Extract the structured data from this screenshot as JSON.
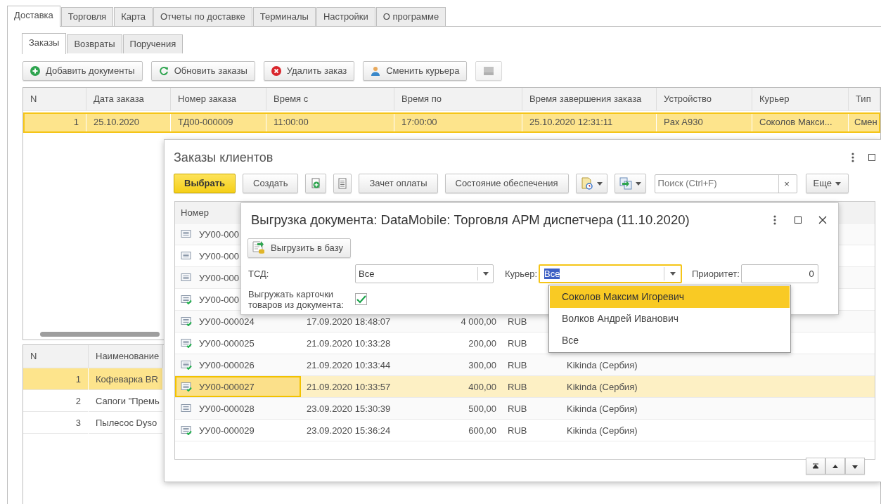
{
  "main_tabs": [
    {
      "label": "Доставка",
      "selected": true
    },
    {
      "label": "Торговля",
      "selected": false
    },
    {
      "label": "Карта",
      "selected": false
    },
    {
      "label": "Отчеты по доставке",
      "selected": false
    },
    {
      "label": "Терминалы",
      "selected": false
    },
    {
      "label": "Настройки",
      "selected": false
    },
    {
      "label": "О программе",
      "selected": false
    }
  ],
  "sub_tabs": [
    {
      "label": "Заказы",
      "selected": true
    },
    {
      "label": "Возвраты",
      "selected": false
    },
    {
      "label": "Поручения",
      "selected": false
    }
  ],
  "toolbar": [
    {
      "label": "Добавить документы",
      "disabled": false
    },
    {
      "label": "Обновить заказы",
      "disabled": false
    },
    {
      "label": "Удалить заказ",
      "disabled": false
    },
    {
      "label": "Сменить курьера",
      "disabled": false
    },
    {
      "disabled": true
    }
  ],
  "orders_table": {
    "columns": [
      "N",
      "Дата заказа",
      "Номер заказа",
      "Время с",
      "Время по",
      "Время завершения заказа",
      "Устройство",
      "Курьер",
      "Тип"
    ],
    "rows": [
      {
        "selected": true,
        "cells": [
          "1",
          "25.10.2020",
          "ТД00-000009",
          "11:00:00",
          "17:00:00",
          "25.10.2020 12:31:11",
          "Pax A930",
          "Соколов Макси...",
          "Смен"
        ]
      }
    ]
  },
  "items_table": {
    "columns": [
      "N",
      "Наименование"
    ],
    "rows": [
      {
        "selected": true,
        "cells": [
          "1",
          "Кофеварка BR"
        ]
      },
      {
        "selected": false,
        "cells": [
          "2",
          "Сапоги \"Премь"
        ]
      },
      {
        "selected": false,
        "cells": [
          "3",
          "Пылесос Dyso"
        ]
      }
    ]
  },
  "orders_window": {
    "title": "Заказы клиентов",
    "toolbar": [
      {
        "kind": "default",
        "label": "Выбрать"
      },
      {
        "kind": "button",
        "label": "Создать"
      },
      {
        "kind": "icon"
      },
      {
        "kind": "icon"
      },
      {
        "kind": "button",
        "label": "Зачет оплаты"
      },
      {
        "kind": "button",
        "label": "Состояние обеспечения"
      },
      {
        "kind": "menu"
      },
      {
        "kind": "menu"
      }
    ],
    "search": {
      "placeholder": "Поиск (Ctrl+F)",
      "clear": "×"
    },
    "more_button": "Еще",
    "table": {
      "columns": [
        "Номер"
      ],
      "rows": [
        {
          "posted": false,
          "selected": false,
          "number": "УУ00-000"
        },
        {
          "posted": false,
          "selected": false,
          "number": "УУ00-000"
        },
        {
          "posted": false,
          "selected": false,
          "number": "УУ00-000"
        },
        {
          "posted": true,
          "selected": false,
          "number": "УУ00-000"
        },
        {
          "posted": true,
          "selected": false,
          "number": "УУ00-000024",
          "date": "17.09.2020 18:48:07",
          "amount": "4 000,00",
          "currency": "RUB"
        },
        {
          "posted": true,
          "selected": false,
          "number": "УУ00-000025",
          "date": "21.09.2020 10:33:28",
          "amount": "200,00",
          "currency": "RUB"
        },
        {
          "posted": true,
          "selected": false,
          "number": "УУ00-000026",
          "date": "21.09.2020 10:33:44",
          "amount": "300,00",
          "currency": "RUB",
          "location": "Kikinda (Сербия)"
        },
        {
          "posted": true,
          "selected": true,
          "number": "УУ00-000027",
          "date": "21.09.2020 10:33:57",
          "amount": "400,00",
          "currency": "RUB",
          "location": "Kikinda (Сербия)"
        },
        {
          "posted": false,
          "selected": false,
          "number": "УУ00-000028",
          "date": "23.09.2020 15:30:39",
          "amount": "500,00",
          "currency": "RUB",
          "location": "Kikinda (Сербия)"
        },
        {
          "posted": true,
          "selected": false,
          "number": "УУ00-000029",
          "date": "23.09.2020 15:36:24",
          "amount": "600,00",
          "currency": "RUB",
          "location": "Kikinda (Сербия)"
        }
      ]
    }
  },
  "export_dialog": {
    "title": "Выгрузка документа: DataMobile: Торговля АРМ диспетчера (11.10.2020)",
    "export_button": "Выгрузить в базу",
    "tsd": {
      "label": "ТСД:",
      "value": "Все"
    },
    "courier": {
      "label": "Курьер:",
      "value": "Все",
      "focused": true
    },
    "priority": {
      "label": "Приоритет:",
      "value": "0"
    },
    "export_cards": {
      "label": "Выгружать карточки товаров из документа:",
      "checked": true
    }
  },
  "courier_dropdown": [
    {
      "label": "Соколов Максим Игоревич",
      "selected": true
    },
    {
      "label": "Волков Андрей Иванович",
      "selected": false
    },
    {
      "label": "Все",
      "selected": false
    }
  ]
}
